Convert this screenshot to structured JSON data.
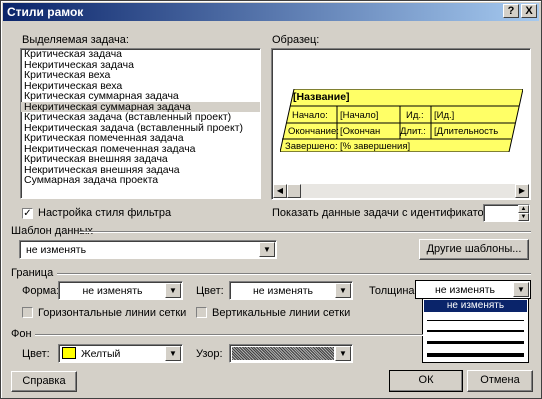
{
  "window": {
    "title": "Стили рамок",
    "help_btn": "?",
    "close_btn": "X"
  },
  "task_list": {
    "label": "Выделяемая задача:",
    "items": [
      "Критическая задача",
      "Некритическая задача",
      "Критическая веха",
      "Некритическая веха",
      "Критическая суммарная задача",
      "Некритическая суммарная задача",
      "Критическая задача (вставленный проект)",
      "Некритическая задача (вставленный проект)",
      "Критическая помеченная задача",
      "Некритическая помеченная задача",
      "Критическая внешняя задача",
      "Некритическая внешняя задача",
      "Суммарная задача проекта"
    ],
    "selected_index": 5
  },
  "filter_style": {
    "label": "Настройка стиля фильтра",
    "checked": true
  },
  "preview": {
    "label": "Образец:",
    "card_title": "[Название]",
    "rows": [
      {
        "l1": "Начало:",
        "v1": "[Начало]",
        "l2": "Ид.:",
        "v2": "[Ид.]"
      },
      {
        "l1": "Окончание:",
        "v1": "[Окончан",
        "l2": "Длит.:",
        "v2": "[Длительность"
      },
      {
        "l1": "Завершено:",
        "v1": "[% завершения]"
      }
    ],
    "fill_color": "#ffff66"
  },
  "show_id": {
    "label": "Показать данные задачи с идентификатором:",
    "value": ""
  },
  "template": {
    "label": "Шаблон данных",
    "value": "не изменять",
    "other_btn": "Другие шаблоны..."
  },
  "border": {
    "label": "Граница",
    "shape_label": "Форма:",
    "shape_value": "не изменять",
    "color_label": "Цвет:",
    "color_value": "не изменять",
    "width_label": "Толщина:",
    "width_value": "не изменять",
    "width_options": [
      "не изменять"
    ],
    "hgrid": "Горизонтальные линии сетки",
    "vgrid": "Вертикальные линии сетки"
  },
  "background": {
    "label": "Фон",
    "color_label": "Цвет:",
    "color_value": "Желтый",
    "swatch": "#ffff00",
    "pattern_label": "Узор:"
  },
  "buttons": {
    "help": "Справка",
    "ok": "ОК",
    "cancel": "Отмена"
  }
}
